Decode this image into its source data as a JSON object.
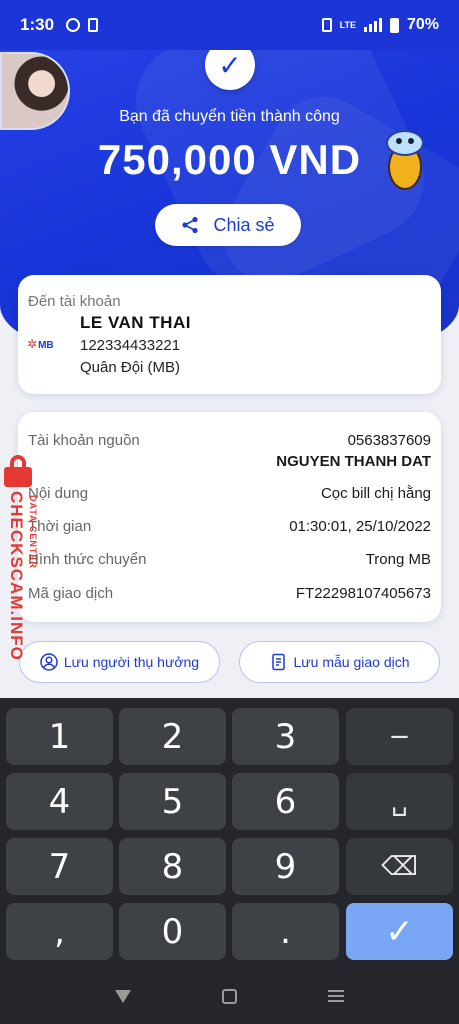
{
  "status_bar": {
    "time": "1:30",
    "network": "LTE",
    "battery": "70%"
  },
  "header": {
    "success_message": "Bạn đã chuyển tiền thành công",
    "amount": "750,000 VND",
    "share_label": "Chia sẻ"
  },
  "recipient": {
    "label": "Đến tài khoản",
    "bank_logo": "MB",
    "name": "LE VAN THAI",
    "account_number": "122334433221",
    "bank_name": "Quân Đội (MB)"
  },
  "details": {
    "source_label": "Tài khoản nguồn",
    "source_account": "0563837609",
    "source_name": "NGUYEN THANH DAT",
    "content_label": "Nội dung",
    "content_value": "Cọc bill chị hằng",
    "time_label": "Thời gian",
    "time_value": "01:30:01, 25/10/2022",
    "method_label": "Hình thức chuyển",
    "method_value": "Trong MB",
    "txn_label": "Mã giao dịch",
    "txn_value": "FT22298107405673"
  },
  "watermark": {
    "main": "CHECKSCAM.INFO",
    "sub": "DATA CENTER"
  },
  "actions": {
    "save_beneficiary": "Lưu người thụ hưởng",
    "save_template": "Lưu mẫu giao dịch"
  },
  "keyboard": {
    "keys": [
      "1",
      "2",
      "3",
      "−",
      "4",
      "5",
      "6",
      "␣",
      "7",
      "8",
      "9",
      "⌫",
      ",",
      "0",
      ".",
      "✓"
    ]
  },
  "colors": {
    "primary_blue": "#1c3ad8",
    "watermark_red": "#e53935",
    "keyboard_bg": "#24262b",
    "done_key": "#7aa6f6"
  }
}
